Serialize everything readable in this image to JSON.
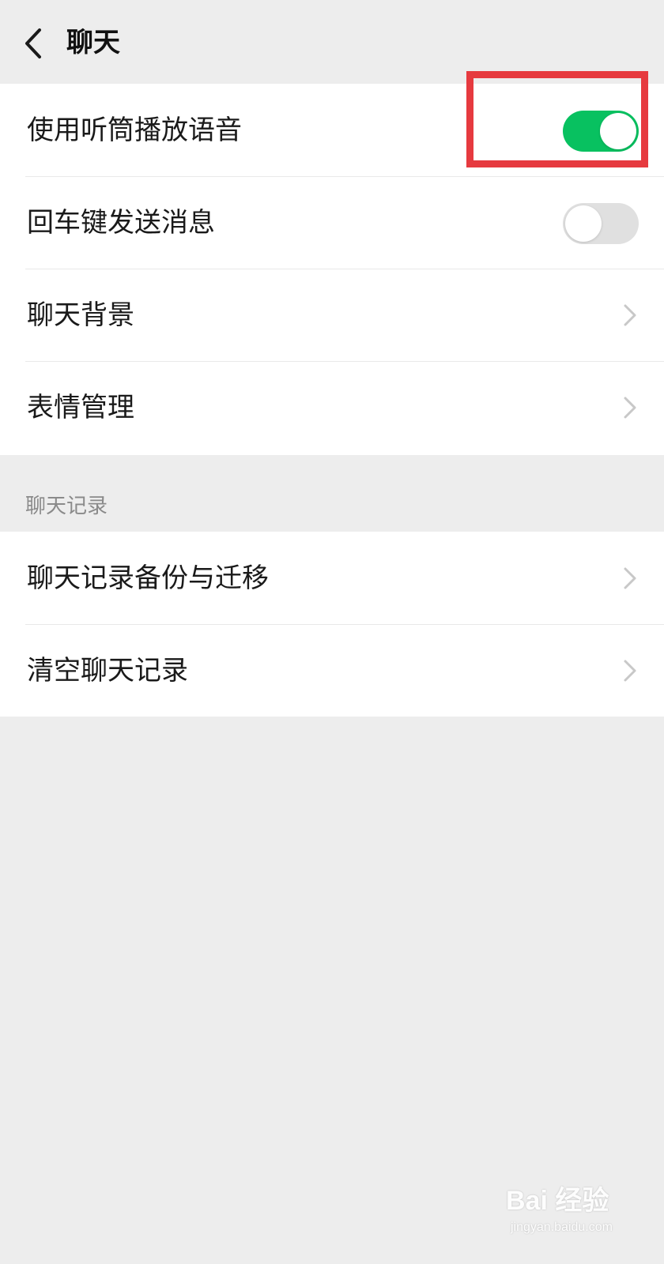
{
  "header": {
    "title": "聊天",
    "back_icon": "chevron-left-icon"
  },
  "settings_group_1": {
    "items": [
      {
        "label": "使用听筒播放语音",
        "control": "toggle",
        "state": "on"
      },
      {
        "label": "回车键发送消息",
        "control": "toggle",
        "state": "off"
      },
      {
        "label": "聊天背景",
        "control": "chevron"
      },
      {
        "label": "表情管理",
        "control": "chevron"
      }
    ]
  },
  "chat_history_section": {
    "title": "聊天记录",
    "items": [
      {
        "label": "聊天记录备份与迁移",
        "control": "chevron"
      },
      {
        "label": "清空聊天记录",
        "control": "chevron"
      }
    ]
  },
  "watermark": {
    "logo_text": "Bai 经验",
    "url": "jingyan.baidu.com"
  },
  "colors": {
    "background": "#ededed",
    "card": "#ffffff",
    "toggle_on": "#08c160",
    "toggle_off": "#e0e0e0",
    "highlight": "#e63a3f",
    "section_text": "#8a8a8a"
  }
}
